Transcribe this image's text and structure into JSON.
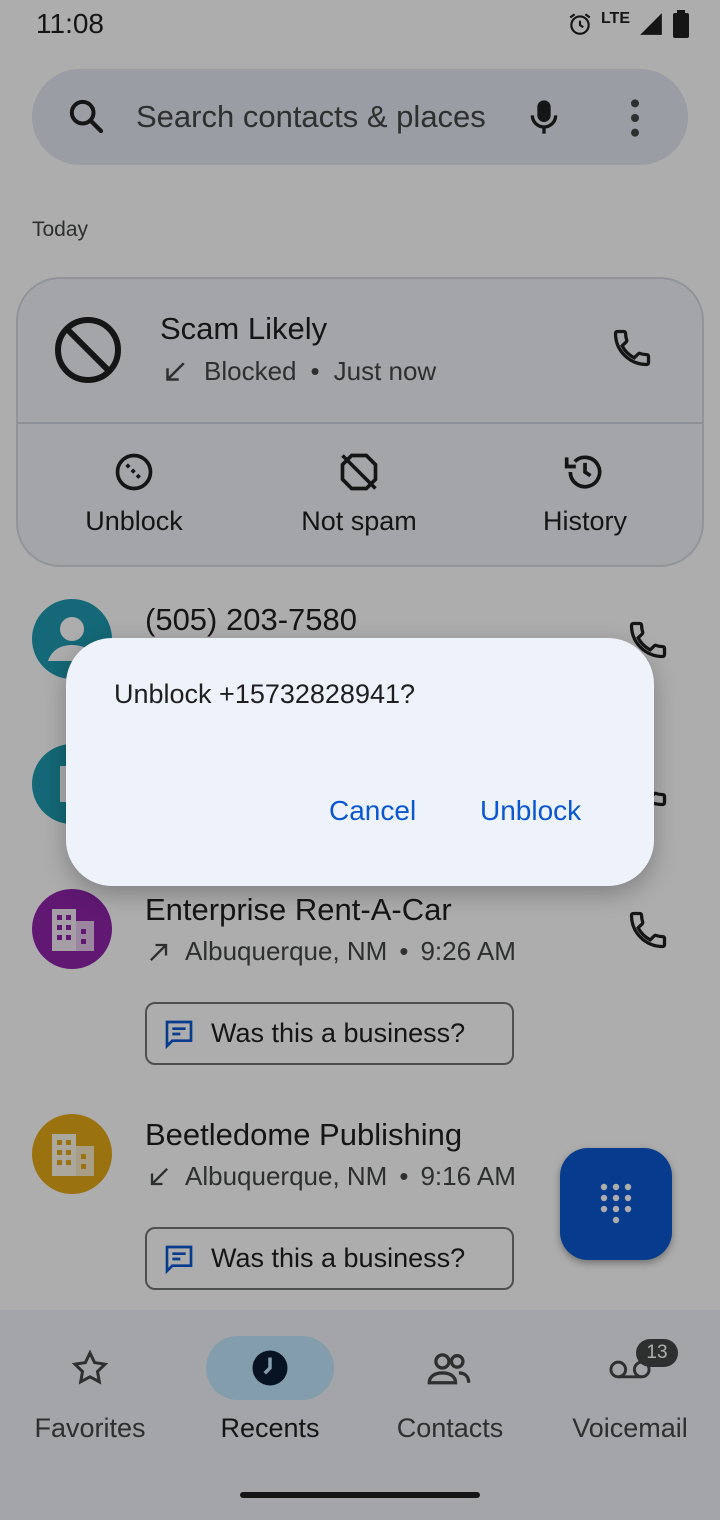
{
  "status_bar": {
    "time": "11:08",
    "network": "LTE",
    "battery": "84"
  },
  "search": {
    "placeholder": "Search contacts & places"
  },
  "sections": {
    "today": "Today"
  },
  "expanded_call": {
    "name": "Scam Likely",
    "status": "Blocked",
    "time": "Just now",
    "separator": "•",
    "actions": {
      "unblock": "Unblock",
      "not_spam": "Not spam",
      "history": "History"
    }
  },
  "calls": [
    {
      "title": "(505) 203-7580",
      "avatar_color": "#1e9ab0"
    },
    {
      "title": "",
      "avatar_color": "#1e9ab0"
    },
    {
      "title": "Enterprise Rent-A-Car",
      "location": "Albuquerque, NM",
      "separator": "•",
      "time": "9:26 AM",
      "direction": "outgoing",
      "avatar_color": "#8e24aa",
      "chip": "Was this a business?"
    },
    {
      "title": "Beetledome Publishing",
      "location": "Albuquerque, NM",
      "separator": "•",
      "time": "9:16 AM",
      "direction": "incoming",
      "avatar_color": "#e3a919",
      "chip": "Was this a business?"
    }
  ],
  "bottom_nav": {
    "favorites": "Favorites",
    "recents": "Recents",
    "contacts": "Contacts",
    "voicemail": "Voicemail",
    "voicemail_badge": "13",
    "active": "recents"
  },
  "dialog": {
    "title": "Unblock +15732828941?",
    "cancel": "Cancel",
    "confirm": "Unblock"
  },
  "colors": {
    "accent": "#0b57d0",
    "scrim": "rgba(0,0,0,0.32)"
  }
}
